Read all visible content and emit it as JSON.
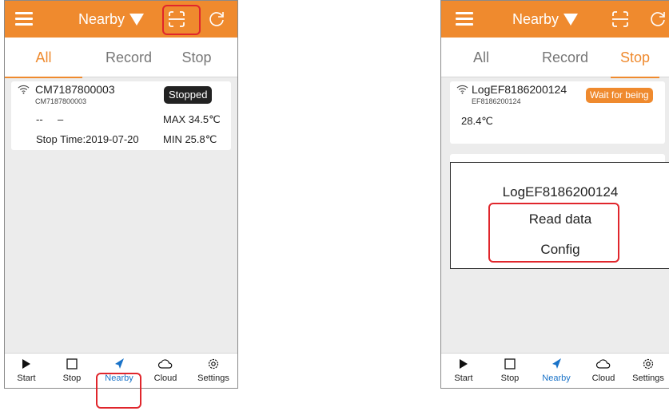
{
  "left": {
    "header": {
      "title": "Nearby"
    },
    "tabs": [
      {
        "label": "All",
        "active": true
      },
      {
        "label": "Record",
        "active": false
      },
      {
        "label": "Stop",
        "active": false
      }
    ],
    "device": {
      "name": "CM7187800003",
      "id": "CM7187800003",
      "status": "Stopped",
      "reading_a": "--",
      "reading_b": "–",
      "max": "MAX 34.5℃",
      "stop_time": "Stop Time:2019-07-20",
      "min": "MIN 25.8℃"
    }
  },
  "right": {
    "header": {
      "title": "Nearby"
    },
    "tabs": [
      {
        "label": "All",
        "active": false
      },
      {
        "label": "Record",
        "active": false
      },
      {
        "label": "Stop",
        "active": true
      }
    ],
    "device": {
      "name": "LogEF8186200124",
      "id": "EF8186200124",
      "status": "Wait for being",
      "temperature": "28.4℃"
    },
    "dialog": {
      "title": "LogEF8186200124",
      "read_data": "Read data",
      "config": "Config"
    }
  },
  "nav": [
    {
      "label": "Start",
      "icon": "play-icon"
    },
    {
      "label": "Stop",
      "icon": "square-icon"
    },
    {
      "label": "Nearby",
      "icon": "compass-icon"
    },
    {
      "label": "Cloud",
      "icon": "cloud-icon"
    },
    {
      "label": "Settings",
      "icon": "gear-icon"
    }
  ],
  "colors": {
    "accent": "#ef8a2e",
    "active_nav": "#1a73c8",
    "highlight": "#e0262c"
  }
}
